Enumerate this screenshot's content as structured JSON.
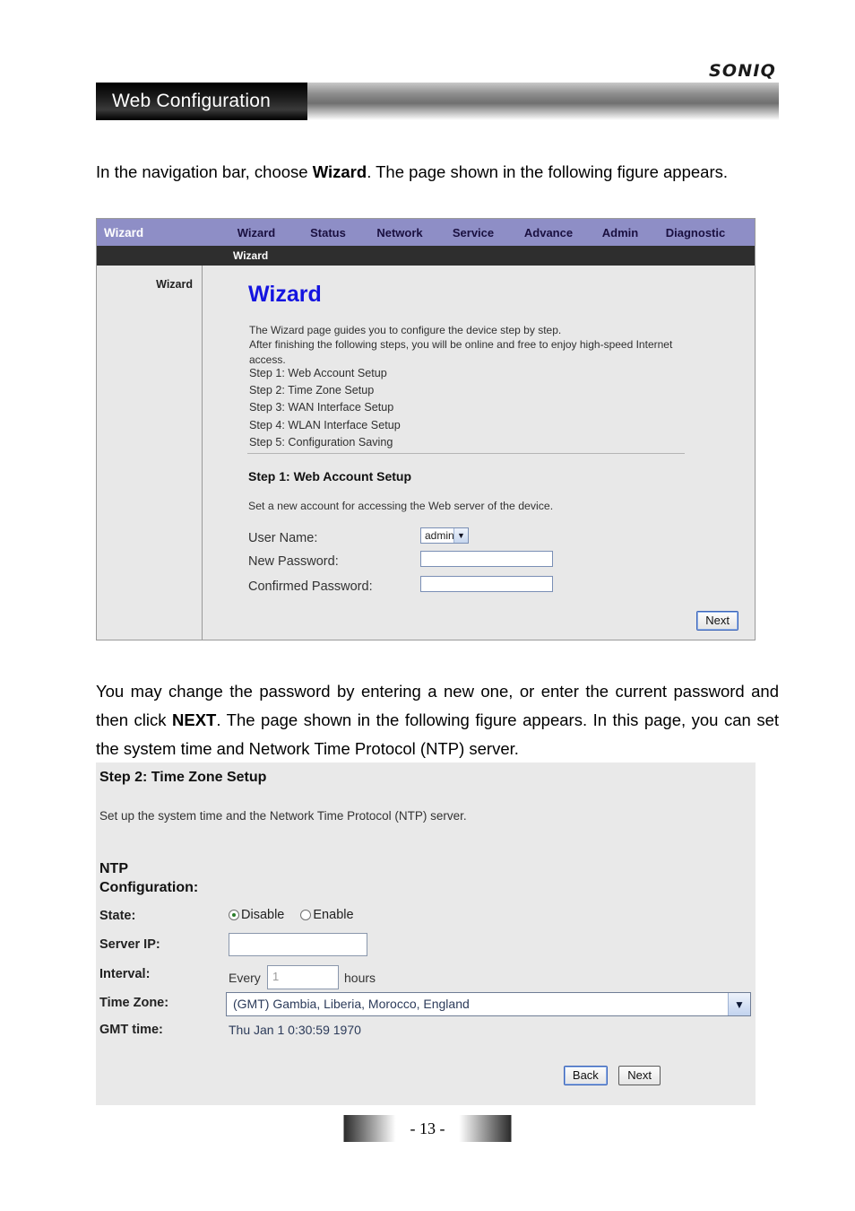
{
  "header": {
    "logo_text": "SONIQ",
    "banner_title": "Web Configuration"
  },
  "paragraphs": {
    "p1_before": "In the navigation bar, choose ",
    "p1_bold": "Wizard",
    "p1_after": ". The page shown in the following figure appears.",
    "p2_before": "You may change the password by entering a new one, or enter the current password and then click ",
    "p2_bold": "NEXT",
    "p2_after": ". The page shown in the following figure appears. In this page, you can set the system time and Network Time Protocol (NTP) server."
  },
  "figure1": {
    "navbar": {
      "brand": "Wizard",
      "items": [
        {
          "label": "Wizard"
        },
        {
          "label": "Status"
        },
        {
          "label": "Network"
        },
        {
          "label": "Service"
        },
        {
          "label": "Advance"
        },
        {
          "label": "Admin"
        },
        {
          "label": "Diagnostic"
        }
      ],
      "background_color": "#8e8ec6"
    },
    "subbar": {
      "label": "Wizard",
      "background_color": "#2e2e2e"
    },
    "sidebar": {
      "items": [
        {
          "label": "Wizard"
        }
      ]
    },
    "content": {
      "heading": "Wizard",
      "heading_color": "#1414e0",
      "description": "The Wizard page guides you to configure the device step by step.\nAfter finishing the following steps, you will be online and free to enjoy high-speed Internet access.",
      "steps": "Step 1: Web Account Setup\nStep 2: Time Zone Setup\nStep 3: WAN Interface Setup\nStep 4: WLAN Interface Setup\nStep 5: Configuration Saving",
      "step1_title": "Step 1: Web Account Setup",
      "step1_desc": "Set a new account for accessing the Web server of the device.",
      "form": {
        "user_name_label": "User Name:",
        "user_name_value": "admin",
        "new_password_label": "New Password:",
        "new_password_value": "",
        "confirmed_password_label": "Confirmed Password:",
        "confirmed_password_value": "",
        "dropdown_icon": "chevron-down-icon"
      },
      "next_label": "Next"
    }
  },
  "figure2": {
    "title": "Step 2: Time Zone Setup",
    "description": "Set up the system time and the Network Time Protocol (NTP) server.",
    "ntp_heading": "NTP\nConfiguration:",
    "rows": {
      "state_label": "State:",
      "state_disable": "Disable",
      "state_enable": "Enable",
      "state_selected": "Disable",
      "server_ip_label": "Server IP:",
      "server_ip_value": "",
      "interval_label": "Interval:",
      "interval_prefix": "Every",
      "interval_value": "1",
      "interval_suffix": "hours",
      "time_zone_label": "Time Zone:",
      "time_zone_value": "(GMT) Gambia, Liberia, Morocco, England",
      "gmt_time_label": "GMT time:",
      "gmt_time_value": "Thu Jan 1 0:30:59 1970"
    },
    "buttons": {
      "back_label": "Back",
      "next_label": "Next"
    }
  },
  "footer": {
    "page_number": "- 13 -"
  }
}
